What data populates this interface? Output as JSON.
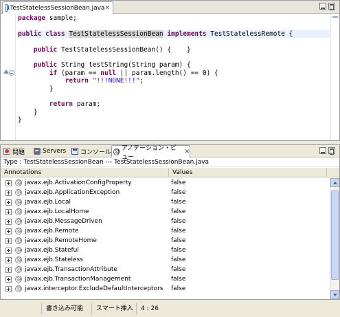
{
  "editor": {
    "tab_label": "TestStatelessSessionBean.java",
    "tab_close": "✕",
    "code_lines": [
      {
        "segments": [
          {
            "t": "package",
            "c": "kw"
          },
          {
            "t": " sample;",
            "c": ""
          }
        ]
      },
      {
        "segments": []
      },
      {
        "segments": [
          {
            "t": "public class ",
            "c": "kw"
          },
          {
            "t": "TestStatelessSessionBean",
            "c": "hl-word"
          },
          {
            "t": " ",
            "c": ""
          },
          {
            "t": "implements",
            "c": "kw"
          },
          {
            "t": " TestStatelessRemote {",
            "c": ""
          }
        ],
        "highlight": true
      },
      {
        "segments": []
      },
      {
        "segments": [
          {
            "t": "    ",
            "c": ""
          },
          {
            "t": "public",
            "c": "kw"
          },
          {
            "t": " TestStatelessSessionBean() {    }",
            "c": ""
          }
        ]
      },
      {
        "segments": []
      },
      {
        "segments": [
          {
            "t": "    ",
            "c": ""
          },
          {
            "t": "public",
            "c": "kw"
          },
          {
            "t": " String testString(String param) {",
            "c": ""
          }
        ]
      },
      {
        "segments": [
          {
            "t": "        ",
            "c": ""
          },
          {
            "t": "if",
            "c": "kw"
          },
          {
            "t": " (param == ",
            "c": ""
          },
          {
            "t": "null",
            "c": "kw"
          },
          {
            "t": " || param.length() == 0) {",
            "c": ""
          }
        ]
      },
      {
        "segments": [
          {
            "t": "            ",
            "c": ""
          },
          {
            "t": "return",
            "c": "kw"
          },
          {
            "t": " ",
            "c": ""
          },
          {
            "t": "\"!!!NONE!!!\"",
            "c": "str"
          },
          {
            "t": ";",
            "c": ""
          }
        ]
      },
      {
        "segments": [
          {
            "t": "        }",
            "c": ""
          }
        ]
      },
      {
        "segments": []
      },
      {
        "segments": [
          {
            "t": "        ",
            "c": ""
          },
          {
            "t": "return",
            "c": "kw"
          },
          {
            "t": " param;",
            "c": ""
          }
        ]
      },
      {
        "segments": [
          {
            "t": "    }",
            "c": ""
          }
        ]
      },
      {
        "segments": [
          {
            "t": "}",
            "c": ""
          }
        ]
      }
    ]
  },
  "panel": {
    "tabs": [
      {
        "label": "問題",
        "icon": "problems-icon"
      },
      {
        "label": "Servers",
        "icon": "servers-icon"
      },
      {
        "label": "コンソール",
        "icon": "console-icon"
      },
      {
        "label": "アノテーション・ビュー",
        "icon": "annotation-icon",
        "active": true
      }
    ],
    "active_tab_close": "✕",
    "type_line": "Type : TestStatelessSessionBean --- TestStatelessSessionBean.java",
    "columns": [
      "Annotations",
      "Values"
    ],
    "rows": [
      {
        "name": "javax.ejb.ActivationConfigProperty",
        "value": "false"
      },
      {
        "name": "javax.ejb.ApplicationException",
        "value": "false"
      },
      {
        "name": "javax.ejb.Local",
        "value": "false"
      },
      {
        "name": "javax.ejb.LocalHome",
        "value": "false"
      },
      {
        "name": "javax.ejb.MessageDriven",
        "value": "false"
      },
      {
        "name": "javax.ejb.Remote",
        "value": "false"
      },
      {
        "name": "javax.ejb.RemoteHome",
        "value": "false"
      },
      {
        "name": "javax.ejb.Stateful",
        "value": "false"
      },
      {
        "name": "javax.ejb.Stateless",
        "value": "false"
      },
      {
        "name": "javax.ejb.TransactionAttribute",
        "value": "false"
      },
      {
        "name": "javax.ejb.TransactionManagement",
        "value": "false"
      },
      {
        "name": "javax.interceptor.ExcludeDefaultInterceptors",
        "value": "false"
      }
    ]
  },
  "status": {
    "write_mode": "書き込み可能",
    "insert_mode": "スマート挿入",
    "position": "4 : 26"
  }
}
